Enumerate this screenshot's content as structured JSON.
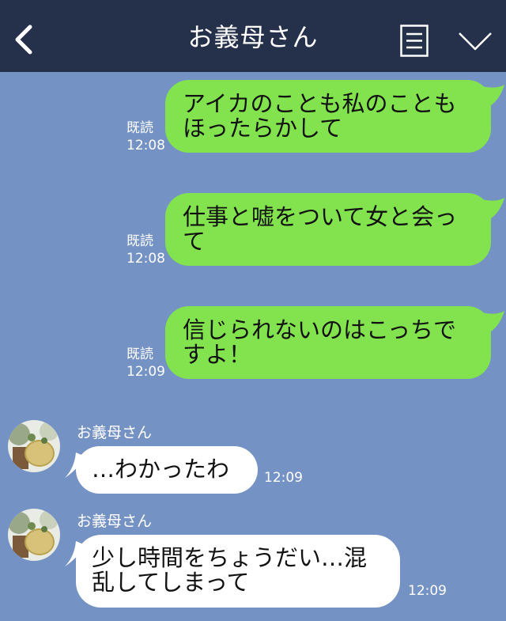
{
  "header": {
    "title": "お義母さん"
  },
  "messages_out": [
    {
      "text": "アイカのことも私のこともほったらかして",
      "read": "既読",
      "time": "12:08"
    },
    {
      "text": "仕事と嘘をついて女と会って",
      "read": "既読",
      "time": "12:08"
    },
    {
      "text": "信じられないのはこっちですよ！",
      "read": "既読",
      "time": "12:09"
    }
  ],
  "messages_in": [
    {
      "sender": "お義母さん",
      "text": "…わかったわ",
      "time": "12:09"
    },
    {
      "sender": "お義母さん",
      "text": "少し時間をちょうだい…混乱してしまって",
      "time": "12:09"
    }
  ],
  "colors": {
    "background": "#7592c4",
    "header": "#25304a",
    "outgoing_bubble": "#83e34f",
    "incoming_bubble": "#ffffff"
  },
  "icons": [
    "back-chevron-icon",
    "menu-icon",
    "chevron-down-icon"
  ]
}
